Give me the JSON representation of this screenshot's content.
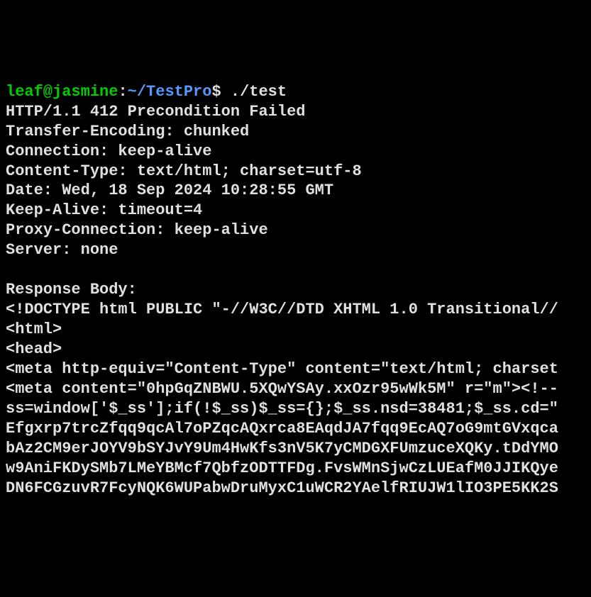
{
  "prompt": {
    "user_host": "leaf@jasmine",
    "colon": ":",
    "path": "~/TestPro",
    "dollar": "$ ",
    "command": "./test"
  },
  "lines": [
    "HTTP/1.1 412 Precondition Failed",
    "Transfer-Encoding: chunked",
    "Connection: keep-alive",
    "Content-Type: text/html; charset=utf-8",
    "Date: Wed, 18 Sep 2024 10:28:55 GMT",
    "Keep-Alive: timeout=4",
    "Proxy-Connection: keep-alive",
    "Server: none",
    "",
    "Response Body:",
    "<!DOCTYPE html PUBLIC \"-//W3C//DTD XHTML 1.0 Transitional//",
    "<html>",
    "<head>",
    "<meta http-equiv=\"Content-Type\" content=\"text/html; charset",
    "<meta content=\"0hpGqZNBWU.5XQwYSAy.xxOzr95wWk5M\" r=\"m\"><!--",
    "ss=window['$_ss'];if(!$_ss)$_ss={};$_ss.nsd=38481;$_ss.cd=\"",
    "Efgxrp7trcZfqq9qcAl7oPZqcAQxrca8EAqdJA7fqq9EcAQ7oG9mtGVxqca",
    "bAz2CM9erJOYV9bSYJvY9Um4HwKfs3nV5K7yCMDGXFUmzuceXQKy.tDdYMO",
    "w9AniFKDySMb7LMeYBMcf7QbfzODTTFDg.FvsWMnSjwCzLUEafM0JJIKQye",
    "DN6FCGzuvR7FcyNQK6WUPabwDruMyxC1uWCR2YAelfRIUJW1lIO3PE5KK2S"
  ]
}
